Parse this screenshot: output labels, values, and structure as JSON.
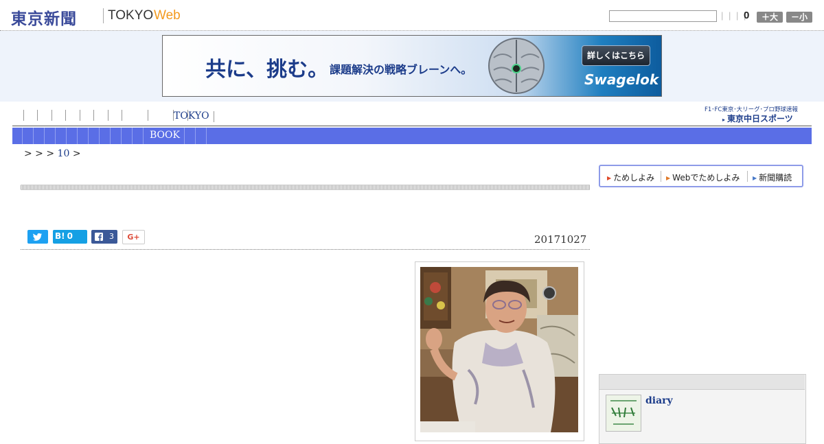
{
  "header": {
    "logo_jp": "東京新聞",
    "logo_tokyo": "TOKYO",
    "logo_web": "Web",
    "search_value": "",
    "counter_separators": "| | | |",
    "counter_value": "0",
    "font_large_label": "＋大",
    "font_small_label": "－小"
  },
  "ad": {
    "headline": "共に、挑む。",
    "subline": "課題解決の戦略ブレーンへ。",
    "cta_label": "詳しくはこちら",
    "brand": "Swagelok"
  },
  "nav": {
    "region_label": "TOKYO",
    "chunichi_tagline": "F1･FC東京･大リーグ･プロ野球速報",
    "chunichi_logo": "東京中日スポーツ"
  },
  "category_bar": {
    "active_label": "BOOK"
  },
  "breadcrumb": {
    "prefix": "> > >",
    "number": "10",
    "suffix": ">"
  },
  "tabs": [
    {
      "label": "ためしよみ",
      "arrow_color": "#e04a2a"
    },
    {
      "label": "Webでためしよみ",
      "arrow_color": "#e07a2a"
    },
    {
      "label": "新聞購読",
      "arrow_color": "#4a7ac8"
    }
  ],
  "share": {
    "hatena_label": "B!",
    "hatena_count": "0",
    "facebook_count": "3",
    "gplus_label": "G+"
  },
  "article": {
    "date": "20171027"
  },
  "sidebar": {
    "diary_title": "diary"
  },
  "colors": {
    "brand_blue": "#3a4a9a",
    "nav_bar": "#5a6ee6",
    "web_orange": "#f39a1e",
    "twitter": "#1da1f2",
    "facebook": "#3b5998"
  }
}
